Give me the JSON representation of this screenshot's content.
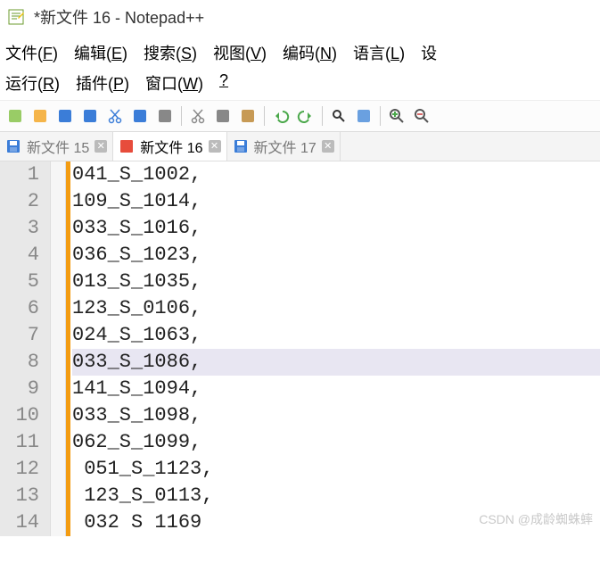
{
  "window": {
    "title": "*新文件 16 - Notepad++"
  },
  "menu": {
    "row1": [
      {
        "label": "文件(",
        "u": "F",
        "after": ")"
      },
      {
        "label": "编辑(",
        "u": "E",
        "after": ")"
      },
      {
        "label": "搜索(",
        "u": "S",
        "after": ")"
      },
      {
        "label": "视图(",
        "u": "V",
        "after": ")"
      },
      {
        "label": "编码(",
        "u": "N",
        "after": ")"
      },
      {
        "label": "语言(",
        "u": "L",
        "after": ")"
      },
      {
        "label": "设",
        "u": "",
        "after": ""
      }
    ],
    "row2": [
      {
        "label": "运行(",
        "u": "R",
        "after": ")"
      },
      {
        "label": "插件(",
        "u": "P",
        "after": ")"
      },
      {
        "label": "窗口(",
        "u": "W",
        "after": ")"
      },
      {
        "label": "",
        "u": "?",
        "after": ""
      }
    ]
  },
  "toolbar_icons": [
    "new",
    "open",
    "save",
    "copy",
    "cut",
    "close",
    "print",
    "sep",
    "cut2",
    "copy2",
    "paste",
    "sep",
    "undo",
    "redo",
    "sep",
    "find",
    "replace",
    "sep",
    "zoom-in",
    "zoom-out"
  ],
  "tabs": [
    {
      "label": "新文件 15",
      "active": false,
      "unsaved": false
    },
    {
      "label": "新文件 16",
      "active": true,
      "unsaved": true
    },
    {
      "label": "新文件 17",
      "active": false,
      "unsaved": false
    }
  ],
  "editor": {
    "highlight_line": 8,
    "lines": [
      "041_S_1002,",
      "109_S_1014,",
      "033_S_1016,",
      "036_S_1023,",
      "013_S_1035,",
      "123_S_0106,",
      "024_S_1063,",
      "033_S_1086,",
      "141_S_1094,",
      "033_S_1098,",
      "062_S_1099,",
      " 051_S_1123,",
      " 123_S_0113,",
      " 032 S 1169"
    ]
  },
  "watermark": "CSDN @成龄蜘蛛蟀"
}
